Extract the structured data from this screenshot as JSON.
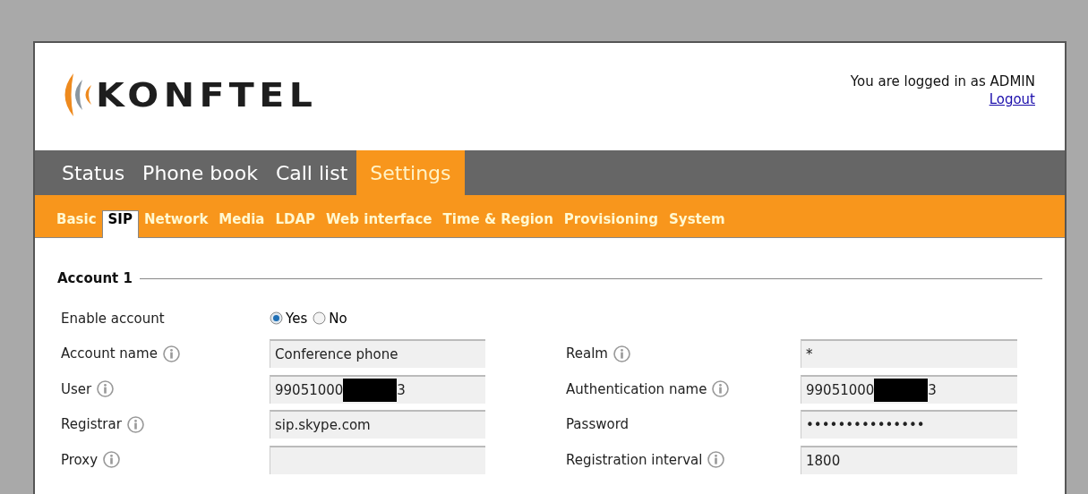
{
  "header": {
    "logo": "KONFTEL",
    "user_text": "You are logged in as ADMIN",
    "logout": "Logout"
  },
  "main_tabs": [
    {
      "label": "Status",
      "selected": false
    },
    {
      "label": "Phone book",
      "selected": false
    },
    {
      "label": "Call list",
      "selected": false
    },
    {
      "label": "Settings",
      "selected": true
    }
  ],
  "sub_tabs": [
    {
      "label": "Basic",
      "selected": false
    },
    {
      "label": "SIP",
      "selected": true
    },
    {
      "label": "Network",
      "selected": false
    },
    {
      "label": "Media",
      "selected": false
    },
    {
      "label": "LDAP",
      "selected": false
    },
    {
      "label": "Web interface",
      "selected": false
    },
    {
      "label": "Time & Region",
      "selected": false
    },
    {
      "label": "Provisioning",
      "selected": false
    },
    {
      "label": "System",
      "selected": false
    }
  ],
  "section": {
    "title": "Account 1"
  },
  "enable": {
    "label": "Enable account",
    "options": [
      {
        "label": "Yes",
        "selected": true
      },
      {
        "label": "No",
        "selected": false
      }
    ]
  },
  "left_fields": [
    {
      "label": "Account name",
      "info": true,
      "value": "Conference phone"
    },
    {
      "label": "User",
      "info": true,
      "value": "99051000",
      "redacted": true,
      "tail": "3"
    },
    {
      "label": "Registrar",
      "info": true,
      "value": "sip.skype.com"
    },
    {
      "label": "Proxy",
      "info": true
    }
  ],
  "right_fields": [
    {
      "label": "Realm",
      "info": true,
      "value": "*"
    },
    {
      "label": "Authentication name",
      "info": true,
      "value": "99051000",
      "redacted": true,
      "tail": "3"
    },
    {
      "label": "Password",
      "info": false,
      "value": "•••••••••••••••"
    },
    {
      "label": "Registration interval",
      "info": true,
      "value": "1800"
    }
  ]
}
